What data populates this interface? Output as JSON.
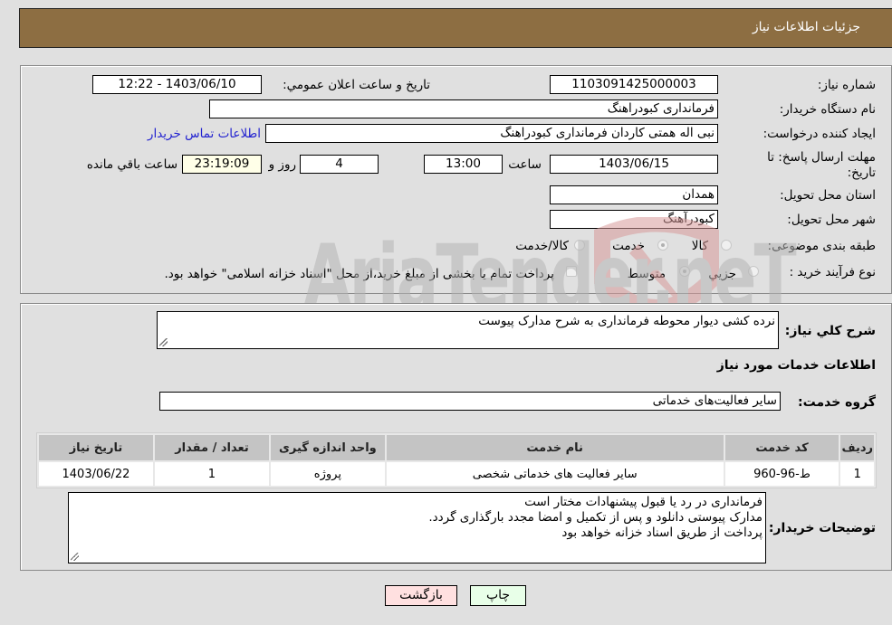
{
  "header": {
    "title": "جزئیات اطلاعات نیاز"
  },
  "form": {
    "need_number_label": "شماره نیاز:",
    "need_number": "1103091425000003",
    "announce_label": "تاریخ و ساعت اعلان عمومي:",
    "announce_value": "1403/06/10 - 12:22",
    "buyer_name_label": "نام دستگاه خریدار:",
    "buyer_name": "فرمانداری کبودراهنگ",
    "creator_label": "ایجاد کننده درخواست:",
    "creator": "نبی اله همتی کاردان فرمانداری کبودراهنگ",
    "contact_link": "اطلاعات تماس خریدار",
    "deadline_label_1": "مهلت ارسال پاسخ: تا",
    "deadline_label_2": "تاریخ:",
    "deadline_date": "1403/06/15",
    "time_label": "ساعت",
    "deadline_time": "13:00",
    "days": "4",
    "days_label": "روز و",
    "remaining_time": "23:19:09",
    "remaining_label": "ساعت باقي مانده",
    "province_label": "استان محل تحویل:",
    "province": "همدان",
    "city_label": "شهر محل تحویل:",
    "city": "کبودرآهنگ",
    "category_label": "طبقه بندی موضوعی:",
    "category_options": [
      {
        "label": "کالا",
        "checked": false
      },
      {
        "label": "خدمت",
        "checked": true
      },
      {
        "label": "کالا/خدمت",
        "checked": false
      }
    ],
    "process_label": "نوع فرآیند خرید :",
    "process_options": [
      {
        "label": "جزيي",
        "checked": false
      },
      {
        "label": "متوسط",
        "checked": true
      }
    ],
    "treasury_note": "پرداخت تمام یا بخشی از مبلغ خرید،از محل \"اسناد خزانه اسلامی\" خواهد بود."
  },
  "details": {
    "description_label": "شرح کلي نياز:",
    "description": "نرده کشی دیوار محوطه فرمانداری به شرح مدارک پیوست",
    "services_heading": "اطلاعات خدمات مورد نیاز",
    "service_group_label": "گروه خدمت:",
    "service_group": "سایر فعالیت‌های خدماتی",
    "table": {
      "headers": [
        "ردیف",
        "کد خدمت",
        "نام خدمت",
        "واحد اندازه گیری",
        "تعداد / مقدار",
        "تاریخ نیاز"
      ],
      "rows": [
        [
          "1",
          "ط-96-960",
          "سایر فعالیت های خدماتی شخصی",
          "پروژه",
          "1",
          "1403/06/22"
        ]
      ]
    },
    "buyer_notes_label": "توضیحات خریدار:",
    "buyer_notes": [
      "فرمانداری در رد یا قبول پیشنهادات مختار است",
      "مدارک پیوستی دانلود و پس از تکمیل و امضا مجدد بارگذاری گردد.",
      "پرداخت از طریق اسناد خزانه خواهد بود"
    ]
  },
  "buttons": {
    "print": "چاپ",
    "back": "بازگشت"
  },
  "watermark": {
    "text": "AriaTender.neT"
  }
}
